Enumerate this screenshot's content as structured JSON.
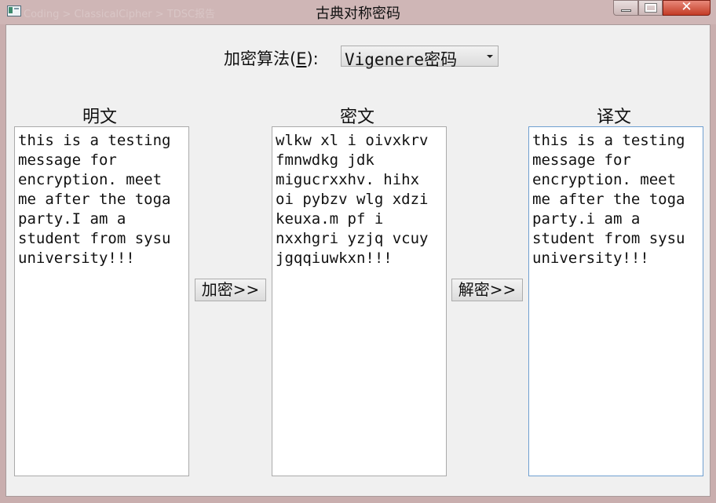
{
  "window": {
    "title": "古典对称密码",
    "breadcrumb_ghost": "Coding > ClassicalCipher > TDSC报告"
  },
  "algorithm": {
    "label_prefix": "加密算法(",
    "label_key": "E",
    "label_suffix": "):",
    "selected": "Vigenere密码"
  },
  "columns": {
    "plaintext_title": "明文",
    "ciphertext_title": "密文",
    "decrypted_title": "译文"
  },
  "texts": {
    "plaintext": "this is a testing message for encryption. meet me after the toga party.I am a student from sysu university!!!",
    "ciphertext": "wlkw xl i oivxkrv fmnwdkg jdk migucrxxhv. hihx oi pybzv wlg xdzi keuxa.m pf i nxxhgri yzjq vcuy jgqqiuwkxn!!!",
    "decrypted": "this is a testing message for encryption. meet me after the toga party.i am a student from sysu university!!!"
  },
  "buttons": {
    "encrypt": "加密>>",
    "decrypt": "解密>>"
  },
  "icons": {
    "app": "app-icon",
    "minimize": "minimize-icon",
    "maximize": "maximize-icon",
    "close": "close-icon",
    "dropdown": "chevron-down-icon"
  }
}
